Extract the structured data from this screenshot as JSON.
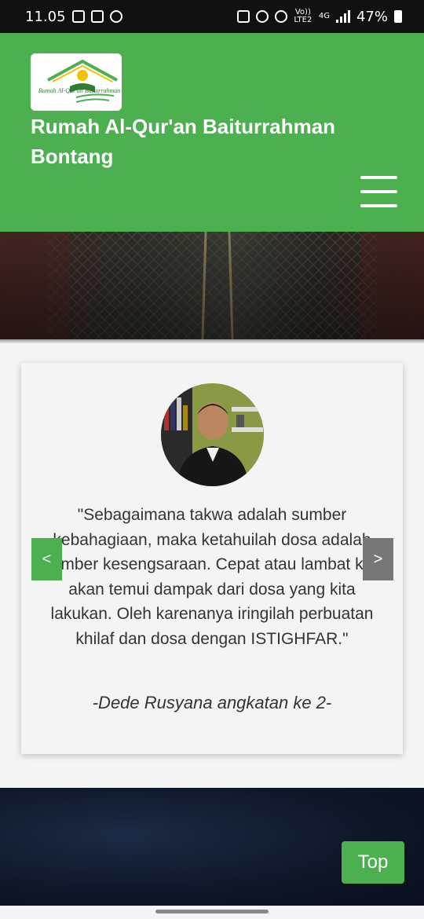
{
  "status_bar": {
    "time": "11.05",
    "battery": "47%",
    "network": "4G",
    "volte": "Vo)) LTE2"
  },
  "header": {
    "logo_text": "Rumah Al-Qur'an Baiturrahman",
    "site_title": "Rumah Al-Qur'an Baiturrahman Bontang",
    "brand_color": "#4caf50"
  },
  "testimonial": {
    "quote": "\"Sebagaimana takwa adalah sumber kebahagiaan, maka ketahuilah dosa adalah sumber kesengsaraan. Cepat atau lambat kita akan temui dampak dari dosa yang kita lakukan. Oleh karenanya iringilah perbuatan khilaf dan dosa dengan ISTIGHFAR.\"",
    "author": "-Dede Rusyana angkatan ke 2-",
    "prev_label": "<",
    "next_label": ">"
  },
  "top_button": {
    "label": "Top"
  },
  "icons": [
    "menu-icon",
    "camera-icon",
    "alarm-icon",
    "hotspot-icon",
    "signal-icon",
    "battery-icon",
    "instagram-icon",
    "facebook-icon"
  ]
}
